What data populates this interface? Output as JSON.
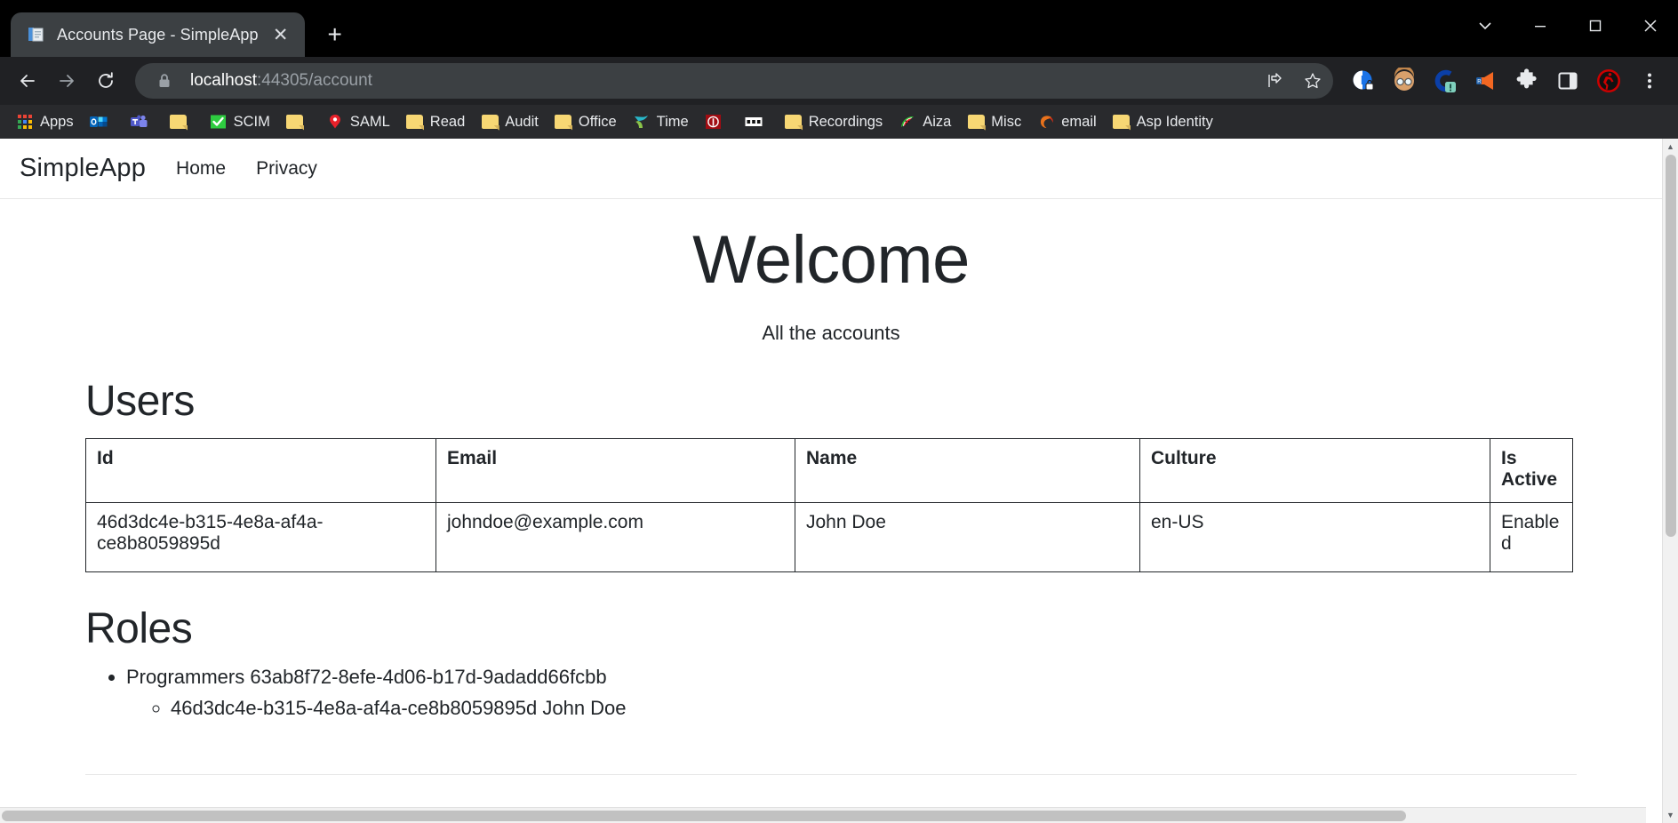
{
  "browser": {
    "tab": {
      "title": "Accounts Page - SimpleApp",
      "favicon_icon": "document-pages-icon",
      "close_icon": "close-icon"
    },
    "new_tab_label": "+",
    "window_controls": [
      {
        "name": "tab-search",
        "icon": "chevron-down-icon",
        "glyph": "⌄"
      },
      {
        "name": "minimize",
        "icon": "minimize-icon",
        "glyph": "—"
      },
      {
        "name": "maximize",
        "icon": "maximize-icon",
        "glyph": "□"
      },
      {
        "name": "close-window",
        "icon": "close-icon",
        "glyph": "✕"
      }
    ],
    "nav_buttons": [
      {
        "name": "back-button",
        "icon": "arrow-left-icon",
        "glyph": "←"
      },
      {
        "name": "forward-button",
        "icon": "arrow-right-icon",
        "glyph": "→"
      },
      {
        "name": "reload-button",
        "icon": "reload-icon",
        "glyph": "⟳"
      }
    ],
    "omnibox": {
      "lock_icon": "lock-icon",
      "url_host": "localhost",
      "url_path": ":44305/account",
      "share_icon": "share-icon",
      "bookmark_icon": "star-icon"
    },
    "extensions": [
      {
        "name": "privacy-badger-extension",
        "icon": "blue-circle-lock-icon"
      },
      {
        "name": "profile-avatar",
        "icon": "avatar-face-icon"
      },
      {
        "name": "sync-extension",
        "icon": "blue-c-alert-icon"
      },
      {
        "name": "announcement-extension",
        "icon": "megaphone-icon"
      },
      {
        "name": "extensions-menu",
        "icon": "puzzle-piece-icon"
      },
      {
        "name": "side-panel",
        "icon": "side-panel-icon"
      },
      {
        "name": "runner-extension",
        "icon": "red-runner-icon"
      },
      {
        "name": "chrome-menu",
        "icon": "three-dot-menu-icon"
      }
    ],
    "bookmarks": [
      {
        "label": "Apps",
        "icon": "apps-grid-icon"
      },
      {
        "label": "",
        "icon": "outlook-icon"
      },
      {
        "label": "",
        "icon": "teams-icon"
      },
      {
        "label": "",
        "icon": "folder-icon"
      },
      {
        "label": "SCIM",
        "icon": "green-check-icon"
      },
      {
        "label": "",
        "icon": "folder-icon"
      },
      {
        "label": "SAML",
        "icon": "red-pin-icon"
      },
      {
        "label": "Read",
        "icon": "folder-icon"
      },
      {
        "label": "Audit",
        "icon": "folder-icon"
      },
      {
        "label": "Office",
        "icon": "folder-icon"
      },
      {
        "label": "Time",
        "icon": "teal-bird-icon"
      },
      {
        "label": "",
        "icon": "red-p-icon"
      },
      {
        "label": "",
        "icon": "black-dots-icon"
      },
      {
        "label": "Recordings",
        "icon": "folder-icon"
      },
      {
        "label": "Aiza",
        "icon": "watermelon-icon"
      },
      {
        "label": "Misc",
        "icon": "folder-icon"
      },
      {
        "label": "email",
        "icon": "firefox-swirl-icon"
      },
      {
        "label": "Asp Identity",
        "icon": "folder-icon"
      }
    ]
  },
  "page": {
    "navbar": {
      "brand": "SimpleApp",
      "links": [
        {
          "label": "Home"
        },
        {
          "label": "Privacy"
        }
      ]
    },
    "hero": {
      "title": "Welcome",
      "subtitle": "All the accounts"
    },
    "users_section": {
      "heading": "Users",
      "columns": [
        "Id",
        "Email",
        "Name",
        "Culture",
        "Is Active"
      ],
      "rows": [
        {
          "id": "46d3dc4e-b315-4e8a-af4a-ce8b8059895d",
          "email": "johndoe@example.com",
          "name": "John Doe",
          "culture": "en-US",
          "is_active": "Enabled"
        }
      ]
    },
    "roles_section": {
      "heading": "Roles",
      "items": [
        {
          "label": "Programmers 63ab8f72-8efe-4d06-b17d-9adadd66fcbb",
          "members": [
            {
              "label": "46d3dc4e-b315-4e8a-af4a-ce8b8059895d John Doe"
            }
          ]
        }
      ]
    }
  },
  "colors": {
    "chrome_dark": "#202124",
    "bookmark_bar": "#292a2d",
    "tab_active": "#3c4043",
    "page_text": "#212529",
    "folder_yellow": "#f7d774"
  }
}
